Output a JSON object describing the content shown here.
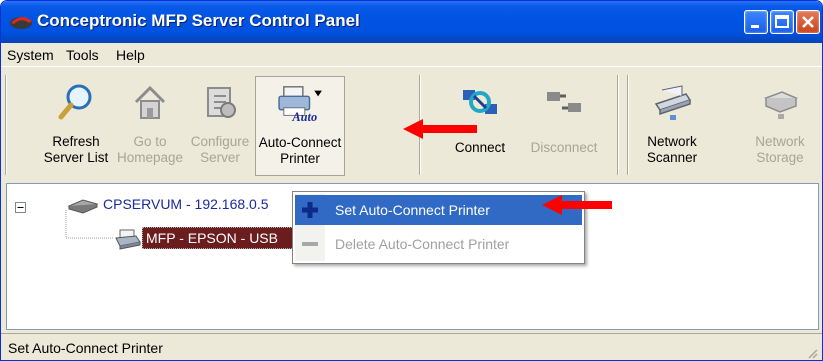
{
  "window": {
    "title": "Conceptronic MFP Server Control Panel"
  },
  "menubar": {
    "items": [
      "System",
      "Tools",
      "Help"
    ]
  },
  "toolbar": {
    "refresh": {
      "line1": "Refresh",
      "line2": "Server List"
    },
    "homepage": {
      "line1": "Go to",
      "line2": "Homepage"
    },
    "configure": {
      "line1": "Configure",
      "line2": "Server"
    },
    "autoconnect": {
      "line1": "Auto-Connect",
      "line2": "Printer",
      "icon_text": "Auto"
    },
    "connect": {
      "label": "Connect"
    },
    "disconnect": {
      "label": "Disconnect"
    },
    "scanner": {
      "line1": "Network",
      "line2": "Scanner"
    },
    "storage": {
      "line1": "Network",
      "line2": "Storage"
    }
  },
  "tree": {
    "server": {
      "label": "CPSERVUM - 192.168.0.5"
    },
    "printer": {
      "label": "MFP - EPSON - USB"
    }
  },
  "context_menu": {
    "items": [
      {
        "label": "Set Auto-Connect Printer",
        "icon": "plus-icon",
        "enabled": true,
        "highlighted": true
      },
      {
        "label": "Delete Auto-Connect Printer",
        "icon": "minus-icon",
        "enabled": false,
        "highlighted": false
      }
    ]
  },
  "status": {
    "text": "Set Auto-Connect Printer"
  },
  "colors": {
    "title_bar": "#0054e3",
    "selection": "#316ac5",
    "tree_selected": "#6b1d1d",
    "arrow": "#ff0000"
  }
}
